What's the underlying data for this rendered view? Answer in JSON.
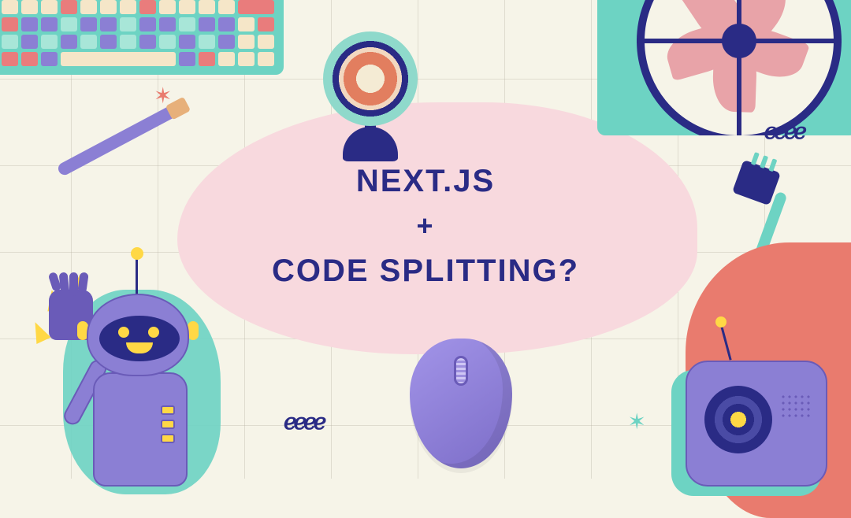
{
  "title": {
    "line1": "Next.js",
    "plus": "+",
    "line2": "Code Splitting?"
  },
  "decor": {
    "squiggle_left": "ℯℯℯℯ",
    "squiggle_right": "ℯℯℯℯ",
    "star_left": "✶",
    "star_right": "✶"
  },
  "icons": {
    "keyboard": "keyboard",
    "fan": "fan",
    "webcam": "webcam",
    "pencil": "cable",
    "plug": "power-plug",
    "mouse": "mouse",
    "robot": "robot-waving",
    "cambot": "camera-robot"
  }
}
